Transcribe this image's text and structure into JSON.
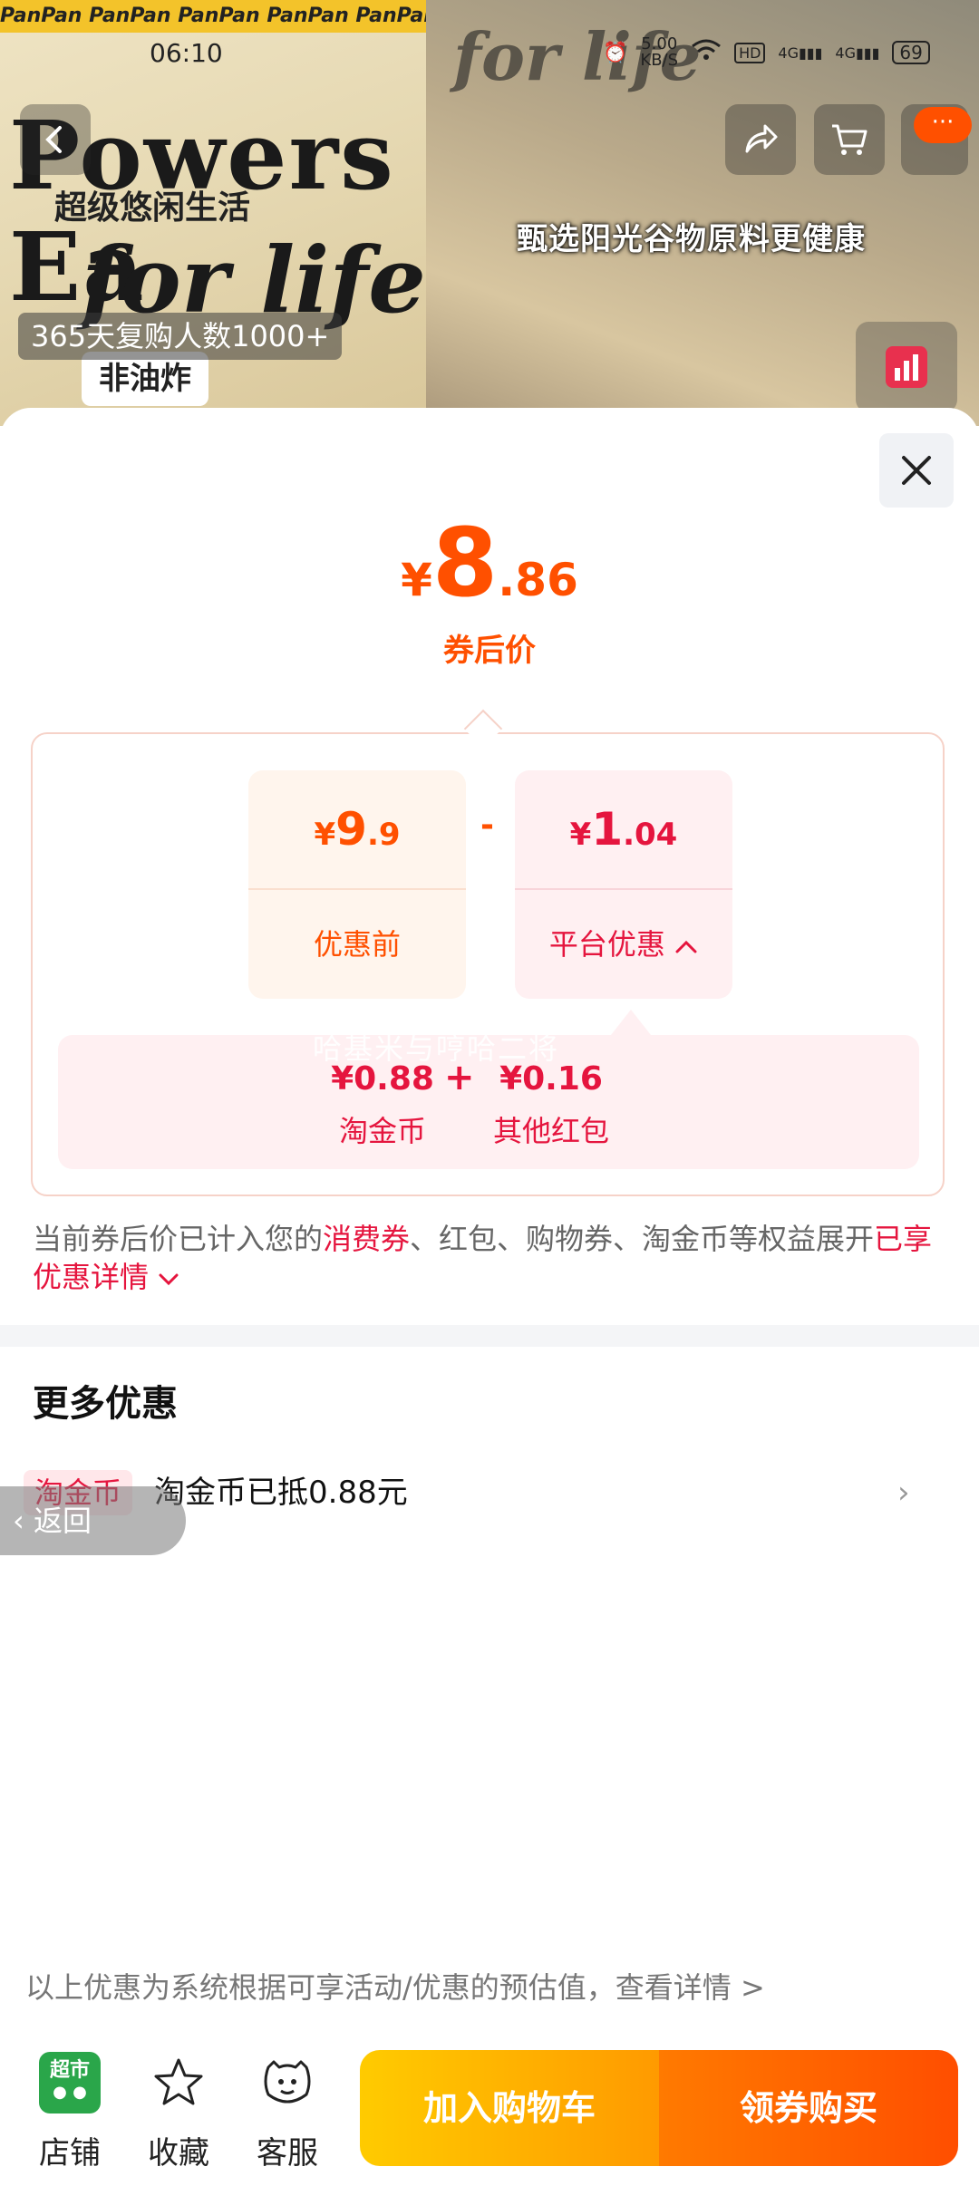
{
  "status_bar": {
    "time": "06:10",
    "speed": "5.00\nKB/S",
    "hd": "HD",
    "net1": "4G",
    "net2": "4G",
    "battery": "69"
  },
  "product_image": {
    "brand_strip": "PanPan  PanPan  PanPan  PanPan  PanPan",
    "headline": "Powers Ea",
    "headline_line2": "for life",
    "subtitle_cn": "超级悠闲生活",
    "sticker": "非油炸",
    "promo_pill": "365天复购人数1000+",
    "caption": "甄选阳光谷物原料更健康",
    "right_overlay": "for life",
    "message_badge": "···"
  },
  "sheet": {
    "price": {
      "currency": "¥",
      "integer": "8",
      "decimal": ".86",
      "caption": "券后价"
    },
    "before": {
      "currency": "¥",
      "integer": "9",
      "decimal": ".9",
      "label": "优惠前"
    },
    "minus": "-",
    "platform": {
      "currency": "¥",
      "integer": "1",
      "decimal": ".04",
      "label": "平台优惠"
    },
    "sub": {
      "a_value": "¥0.88",
      "a_label": "淘金币",
      "plus": "+",
      "b_value": "¥0.16",
      "b_label": "其他红包",
      "overlay": "哈基米与哼哈二将"
    },
    "note": {
      "part1": "当前券后价已计入您的",
      "hl1": "消费券",
      "part2": "、红包、购物券、淘金币等权益展开",
      "hl2": "已享优惠详情"
    },
    "more_title": "更多优惠",
    "coupon": {
      "tag": "淘金币",
      "text": "淘金币已抵0.88元",
      "chevron": "›"
    },
    "back_pill": "返回",
    "footnote": "以上优惠为系统根据可享活动/优惠的预估值，查看详情 >"
  },
  "bottom_bar": {
    "shop_icon_text": "超市",
    "shop": "店铺",
    "favorite": "收藏",
    "service": "客服",
    "add_to_cart": "加入购物车",
    "buy": "领券购买"
  },
  "colors": {
    "accent": "#ff5000",
    "red": "#e5153e",
    "cart_start": "#ffcb00",
    "buy_end": "#ff4e00"
  }
}
